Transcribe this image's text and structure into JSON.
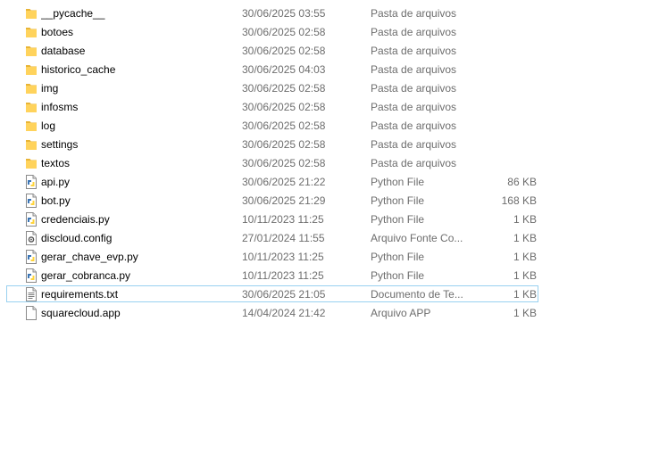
{
  "files": [
    {
      "name": "__pycache__",
      "date": "30/06/2025 03:55",
      "type": "Pasta de arquivos",
      "size": "",
      "icon": "folder-icon"
    },
    {
      "name": "botoes",
      "date": "30/06/2025 02:58",
      "type": "Pasta de arquivos",
      "size": "",
      "icon": "folder-icon"
    },
    {
      "name": "database",
      "date": "30/06/2025 02:58",
      "type": "Pasta de arquivos",
      "size": "",
      "icon": "folder-icon"
    },
    {
      "name": "historico_cache",
      "date": "30/06/2025 04:03",
      "type": "Pasta de arquivos",
      "size": "",
      "icon": "folder-icon"
    },
    {
      "name": "img",
      "date": "30/06/2025 02:58",
      "type": "Pasta de arquivos",
      "size": "",
      "icon": "folder-icon"
    },
    {
      "name": "infosms",
      "date": "30/06/2025 02:58",
      "type": "Pasta de arquivos",
      "size": "",
      "icon": "folder-icon"
    },
    {
      "name": "log",
      "date": "30/06/2025 02:58",
      "type": "Pasta de arquivos",
      "size": "",
      "icon": "folder-icon"
    },
    {
      "name": "settings",
      "date": "30/06/2025 02:58",
      "type": "Pasta de arquivos",
      "size": "",
      "icon": "folder-icon"
    },
    {
      "name": "textos",
      "date": "30/06/2025 02:58",
      "type": "Pasta de arquivos",
      "size": "",
      "icon": "folder-icon"
    },
    {
      "name": "api.py",
      "date": "30/06/2025 21:22",
      "type": "Python File",
      "size": "86 KB",
      "icon": "python-file-icon"
    },
    {
      "name": "bot.py",
      "date": "30/06/2025 21:29",
      "type": "Python File",
      "size": "168 KB",
      "icon": "python-file-icon"
    },
    {
      "name": "credenciais.py",
      "date": "10/11/2023 11:25",
      "type": "Python File",
      "size": "1 KB",
      "icon": "python-file-icon"
    },
    {
      "name": "discloud.config",
      "date": "27/01/2024 11:55",
      "type": "Arquivo Fonte Co...",
      "size": "1 KB",
      "icon": "config-file-icon"
    },
    {
      "name": "gerar_chave_evp.py",
      "date": "10/11/2023 11:25",
      "type": "Python File",
      "size": "1 KB",
      "icon": "python-file-icon"
    },
    {
      "name": "gerar_cobranca.py",
      "date": "10/11/2023 11:25",
      "type": "Python File",
      "size": "1 KB",
      "icon": "python-file-icon"
    },
    {
      "name": "requirements.txt",
      "date": "30/06/2025 21:05",
      "type": "Documento de Te...",
      "size": "1 KB",
      "icon": "text-file-icon",
      "selected": true
    },
    {
      "name": "squarecloud.app",
      "date": "14/04/2024 21:42",
      "type": "Arquivo APP",
      "size": "1 KB",
      "icon": "generic-file-icon"
    }
  ],
  "colors": {
    "folder": "#ffd35c",
    "folder_dark": "#e8b436",
    "python_blue": "#3a74b4",
    "python_yellow": "#ffd43b",
    "selection_border": "#99d1f0"
  }
}
